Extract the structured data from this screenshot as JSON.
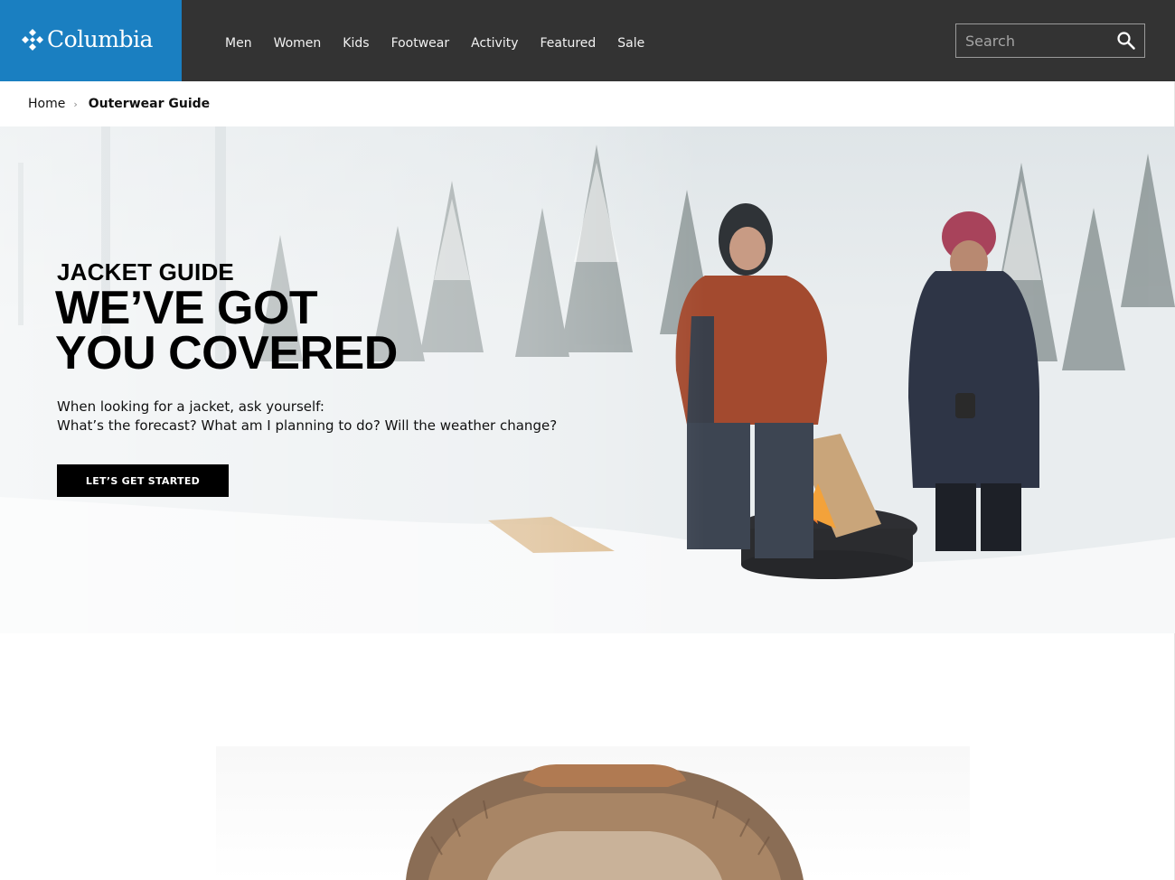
{
  "brand": {
    "name": "Columbia",
    "logo_color": "#1a7fc1"
  },
  "header": {
    "background": "#333333",
    "nav": [
      {
        "label": "Men"
      },
      {
        "label": "Women"
      },
      {
        "label": "Kids"
      },
      {
        "label": "Footwear"
      },
      {
        "label": "Activity"
      },
      {
        "label": "Featured"
      },
      {
        "label": "Sale"
      }
    ],
    "search": {
      "placeholder": "Search",
      "icon": "search-icon"
    }
  },
  "breadcrumb": {
    "home": "Home",
    "separator": "›",
    "current": "Outerwear Guide"
  },
  "hero": {
    "kicker": "JACKET GUIDE",
    "title_line1": "WE’VE GOT",
    "title_line2": "YOU COVERED",
    "copy_line1": "When looking for a jacket, ask yourself:",
    "copy_line2": "What’s the forecast? What am I planning to do? Will the weather change?",
    "cta_label": "LET’S GET STARTED",
    "image": "two-people-by-fire-pit-in-snowy-forest"
  },
  "product_teaser": {
    "image": "fur-trimmed-hood-jacket"
  }
}
